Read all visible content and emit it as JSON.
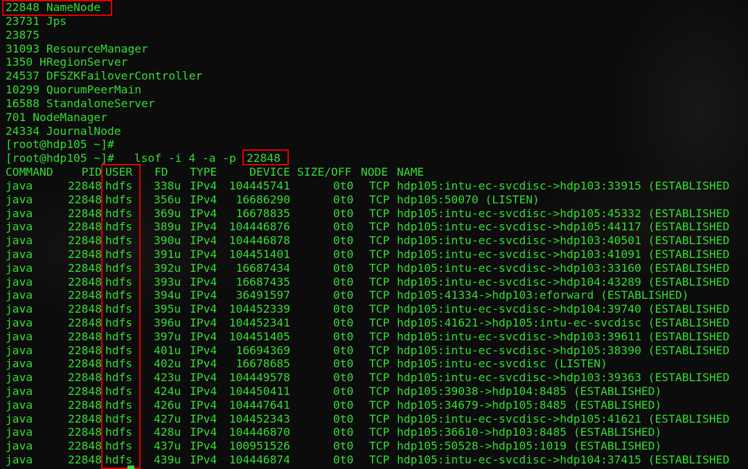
{
  "jps_output": [
    "22848 NameNode",
    "23731 Jps",
    "23875",
    "31093 ResourceManager",
    "1350 HRegionServer",
    "24537 DFSZKFailoverController",
    "10299 QuorumPeerMain",
    "16588 StandaloneServer",
    "701 NodeManager",
    "24334 JournalNode"
  ],
  "prompt_line": "[root@hdp105 ~]#",
  "command_prompt": "[root@hdp105 ~]#",
  "command_text": " lsof -i 4 -a -p",
  "command_pid": "22848",
  "header": {
    "command": "COMMAND",
    "pid": "PID",
    "user": "USER",
    "fd": "FD",
    "type": "TYPE",
    "device": "DEVICE",
    "size": "SIZE/OFF",
    "node": "NODE",
    "name": "NAME"
  },
  "rows": [
    {
      "command": "java",
      "pid": "22848",
      "user": "hdfs",
      "fd": "338u",
      "type": "IPv4",
      "device": "104445741",
      "size": "0t0",
      "node": "TCP",
      "name": "hdp105:intu-ec-svcdisc->hdp103:33915 (ESTABLISHED"
    },
    {
      "command": "java",
      "pid": "22848",
      "user": "hdfs",
      "fd": "356u",
      "type": "IPv4",
      "device": "16686290",
      "size": "0t0",
      "node": "TCP",
      "name": "hdp105:50070 (LISTEN)"
    },
    {
      "command": "java",
      "pid": "22848",
      "user": "hdfs",
      "fd": "369u",
      "type": "IPv4",
      "device": "16678835",
      "size": "0t0",
      "node": "TCP",
      "name": "hdp105:intu-ec-svcdisc->hdp105:45332 (ESTABLISHED"
    },
    {
      "command": "java",
      "pid": "22848",
      "user": "hdfs",
      "fd": "389u",
      "type": "IPv4",
      "device": "104446876",
      "size": "0t0",
      "node": "TCP",
      "name": "hdp105:intu-ec-svcdisc->hdp105:44117 (ESTABLISHED"
    },
    {
      "command": "java",
      "pid": "22848",
      "user": "hdfs",
      "fd": "390u",
      "type": "IPv4",
      "device": "104446878",
      "size": "0t0",
      "node": "TCP",
      "name": "hdp105:intu-ec-svcdisc->hdp103:40501 (ESTABLISHED"
    },
    {
      "command": "java",
      "pid": "22848",
      "user": "hdfs",
      "fd": "391u",
      "type": "IPv4",
      "device": "104451401",
      "size": "0t0",
      "node": "TCP",
      "name": "hdp105:intu-ec-svcdisc->hdp103:41091 (ESTABLISHED"
    },
    {
      "command": "java",
      "pid": "22848",
      "user": "hdfs",
      "fd": "392u",
      "type": "IPv4",
      "device": "16687434",
      "size": "0t0",
      "node": "TCP",
      "name": "hdp105:intu-ec-svcdisc->hdp103:33160 (ESTABLISHED"
    },
    {
      "command": "java",
      "pid": "22848",
      "user": "hdfs",
      "fd": "393u",
      "type": "IPv4",
      "device": "16687435",
      "size": "0t0",
      "node": "TCP",
      "name": "hdp105:intu-ec-svcdisc->hdp104:43289 (ESTABLISHED"
    },
    {
      "command": "java",
      "pid": "22848",
      "user": "hdfs",
      "fd": "394u",
      "type": "IPv4",
      "device": "36491597",
      "size": "0t0",
      "node": "TCP",
      "name": "hdp105:41334->hdp103:eforward (ESTABLISHED)"
    },
    {
      "command": "java",
      "pid": "22848",
      "user": "hdfs",
      "fd": "395u",
      "type": "IPv4",
      "device": "104452339",
      "size": "0t0",
      "node": "TCP",
      "name": "hdp105:intu-ec-svcdisc->hdp104:39740 (ESTABLISHED"
    },
    {
      "command": "java",
      "pid": "22848",
      "user": "hdfs",
      "fd": "396u",
      "type": "IPv4",
      "device": "104452341",
      "size": "0t0",
      "node": "TCP",
      "name": "hdp105:41621->hdp105:intu-ec-svcdisc (ESTABLISHED"
    },
    {
      "command": "java",
      "pid": "22848",
      "user": "hdfs",
      "fd": "397u",
      "type": "IPv4",
      "device": "104451405",
      "size": "0t0",
      "node": "TCP",
      "name": "hdp105:intu-ec-svcdisc->hdp103:39611 (ESTABLISHED"
    },
    {
      "command": "java",
      "pid": "22848",
      "user": "hdfs",
      "fd": "401u",
      "type": "IPv4",
      "device": "16694369",
      "size": "0t0",
      "node": "TCP",
      "name": "hdp105:intu-ec-svcdisc->hdp105:38390 (ESTABLISHED"
    },
    {
      "command": "java",
      "pid": "22848",
      "user": "hdfs",
      "fd": "402u",
      "type": "IPv4",
      "device": "16678685",
      "size": "0t0",
      "node": "TCP",
      "name": "hdp105:intu-ec-svcdisc (LISTEN)"
    },
    {
      "command": "java",
      "pid": "22848",
      "user": "hdfs",
      "fd": "423u",
      "type": "IPv4",
      "device": "104449578",
      "size": "0t0",
      "node": "TCP",
      "name": "hdp105:intu-ec-svcdisc->hdp103:39363 (ESTABLISHED"
    },
    {
      "command": "java",
      "pid": "22848",
      "user": "hdfs",
      "fd": "424u",
      "type": "IPv4",
      "device": "104450411",
      "size": "0t0",
      "node": "TCP",
      "name": "hdp105:39038->hdp104:8485 (ESTABLISHED)"
    },
    {
      "command": "java",
      "pid": "22848",
      "user": "hdfs",
      "fd": "426u",
      "type": "IPv4",
      "device": "104447641",
      "size": "0t0",
      "node": "TCP",
      "name": "hdp105:34679->hdp105:8485 (ESTABLISHED)"
    },
    {
      "command": "java",
      "pid": "22848",
      "user": "hdfs",
      "fd": "427u",
      "type": "IPv4",
      "device": "104452343",
      "size": "0t0",
      "node": "TCP",
      "name": "hdp105:intu-ec-svcdisc->hdp105:41621 (ESTABLISHED"
    },
    {
      "command": "java",
      "pid": "22848",
      "user": "hdfs",
      "fd": "428u",
      "type": "IPv4",
      "device": "104446870",
      "size": "0t0",
      "node": "TCP",
      "name": "hdp105:36610->hdp103:8485 (ESTABLISHED)"
    },
    {
      "command": "java",
      "pid": "22848",
      "user": "hdfs",
      "fd": "437u",
      "type": "IPv4",
      "device": "100951526",
      "size": "0t0",
      "node": "TCP",
      "name": "hdp105:50528->hdp105:1019 (ESTABLISHED)"
    },
    {
      "command": "java",
      "pid": "22848",
      "user": "hdfs",
      "fd": "439u",
      "type": "IPv4",
      "device": "104446874",
      "size": "0t0",
      "node": "TCP",
      "name": "hdp105:intu-ec-svcdisc->hdp104:37415 (ESTABLISHED"
    }
  ],
  "colors": {
    "terminal_text": "#33dd33",
    "background": "#0c0c0c",
    "highlight_box": "#e00000"
  }
}
